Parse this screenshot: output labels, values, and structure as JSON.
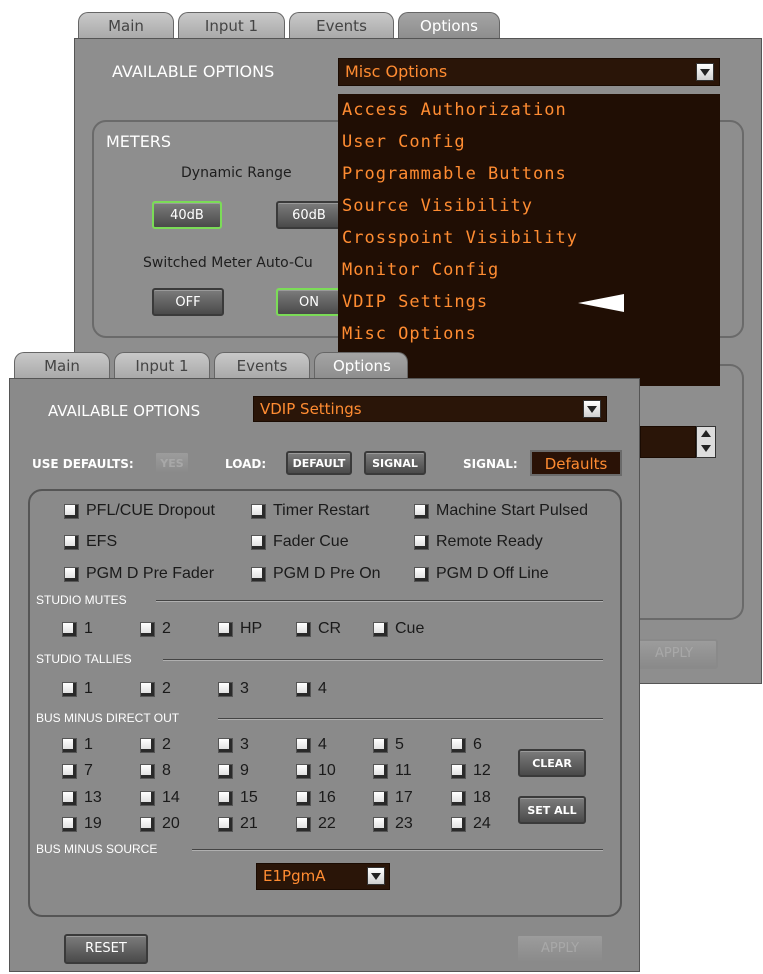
{
  "back_window": {
    "tabs": [
      {
        "label": "Main"
      },
      {
        "label": "Input 1"
      },
      {
        "label": "Events"
      },
      {
        "label": "Options"
      }
    ],
    "available_options_label": "AVAILABLE OPTIONS",
    "selected_option": "Misc Options",
    "menu_items": [
      "Access Authorization",
      "User Config",
      "Programmable Buttons",
      "Source Visibility",
      "Crosspoint Visibility",
      "Monitor Config",
      "VDIP Settings",
      "Misc Options"
    ],
    "meters_title": "METERS",
    "dynamic_range_label": "Dynamic Range",
    "range_40": "40dB",
    "range_60": "60dB",
    "switched_meter_label": "Switched Meter Auto-Cu",
    "off_label": "OFF",
    "on_label": "ON",
    "apply_label": "APPLY"
  },
  "front_window": {
    "tabs": [
      {
        "label": "Main"
      },
      {
        "label": "Input 1"
      },
      {
        "label": "Events"
      },
      {
        "label": "Options"
      }
    ],
    "available_options_label": "AVAILABLE OPTIONS",
    "selected_option": "VDIP Settings",
    "use_defaults_label": "USE DEFAULTS:",
    "yes_label": "YES",
    "load_label": "LOAD:",
    "default_label": "DEFAULT",
    "signal_button_label": "SIGNAL",
    "signal_label": "SIGNAL:",
    "signal_value": "Defaults",
    "options_checks": [
      "PFL/CUE Dropout",
      "Timer Restart",
      "Machine Start Pulsed",
      "EFS",
      "Fader Cue",
      "Remote Ready",
      "PGM D Pre Fader",
      "PGM D Pre On",
      "PGM D Off Line"
    ],
    "studio_mutes_title": "STUDIO MUTES",
    "studio_mutes": [
      "1",
      "2",
      "HP",
      "CR",
      "Cue"
    ],
    "studio_tallies_title": "STUDIO TALLIES",
    "studio_tallies": [
      "1",
      "2",
      "3",
      "4"
    ],
    "bus_minus_direct_out_title": "BUS MINUS DIRECT OUT",
    "bus_minus_direct_out": [
      "1",
      "2",
      "3",
      "4",
      "5",
      "6",
      "7",
      "8",
      "9",
      "10",
      "11",
      "12",
      "13",
      "14",
      "15",
      "16",
      "17",
      "18",
      "19",
      "20",
      "21",
      "22",
      "23",
      "24"
    ],
    "clear_label": "CLEAR",
    "set_all_label": "SET ALL",
    "bus_minus_source_title": "BUS MINUS SOURCE",
    "bus_minus_source_value": "E1PgmA",
    "reset_label": "RESET",
    "apply_label": "APPLY"
  },
  "colors": {
    "panel_gray": "#8e8e8e",
    "dark_field": "#2a1508",
    "orange_text": "#ff8c32",
    "active_green": "#7bdc57"
  }
}
